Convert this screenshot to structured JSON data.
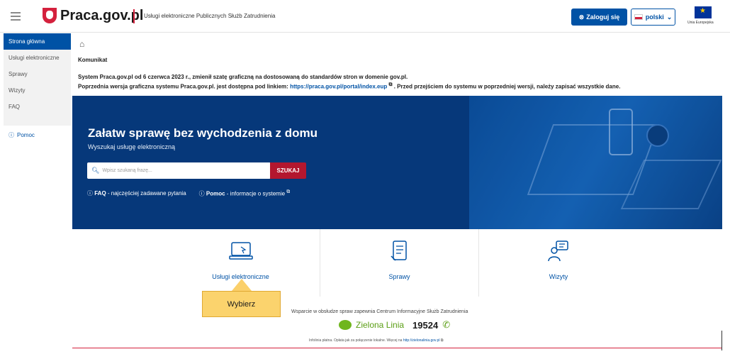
{
  "header": {
    "logo_text": "Praca.gov.pl",
    "subtitle": "Usługi elektroniczne Publicznych Służb Zatrudnienia",
    "login_label": "Zaloguj się",
    "language_label": "polski",
    "eu_label": "Unia Europejska"
  },
  "sidebar": {
    "items": [
      {
        "label": "Strona główna",
        "active": true
      },
      {
        "label": "Usługi elektroniczne"
      },
      {
        "label": "Sprawy"
      },
      {
        "label": "Wizyty"
      },
      {
        "label": "FAQ"
      }
    ],
    "help_label": "Pomoc"
  },
  "message": {
    "title": "Komunikat",
    "line1": "System Praca.gov.pl od 6 czerwca 2023 r., zmienił szatę graficzną na dostosowaną do standardów stron w domenie gov.pl.",
    "line2_prefix": "Poprzednia wersja graficzna systemu Praca.gov.pl. jest dostępna pod linkiem:",
    "line2_link": "https://praca.gov.pl/portal/index.eup",
    "line2_suffix": ". Przed przejściem do systemu w poprzedniej wersji, należy zapisać wszystkie dane."
  },
  "hero": {
    "title": "Załatw sprawę bez wychodzenia z domu",
    "subtitle": "Wyszukaj usługę elektroniczną",
    "search_placeholder": "Wpisz szukaną frazę...",
    "search_button": "SZUKAJ",
    "faq_label": "FAQ",
    "faq_desc": "- najczęściej zadawane pytania",
    "help_label": "Pomoc",
    "help_desc": "- informacje o systemie"
  },
  "cards": [
    {
      "label": "Usługi elektroniczne",
      "icon": "laptop-icon"
    },
    {
      "label": "Sprawy",
      "icon": "document-icon"
    },
    {
      "label": "Wizyty",
      "icon": "visit-icon"
    }
  ],
  "tooltip": {
    "label": "Wybierz"
  },
  "footer": {
    "support_text": "Wsparcie w obsłudze spraw zapewnia Centrum Informacyjne Służb Zatrudnienia",
    "line_name": "Zielona Linia",
    "line_number": "19524",
    "fine_print": "Infolinia płatna. Opłata jak za połączenie lokalne. Więcej na",
    "fine_link": "http://zielonalinia.gov.pl"
  },
  "colors": {
    "brand_blue": "#0052a5",
    "hero_bg": "#06387a",
    "accent_red": "#b3172f",
    "tooltip": "#fbd36d",
    "green": "#6fb61d"
  }
}
